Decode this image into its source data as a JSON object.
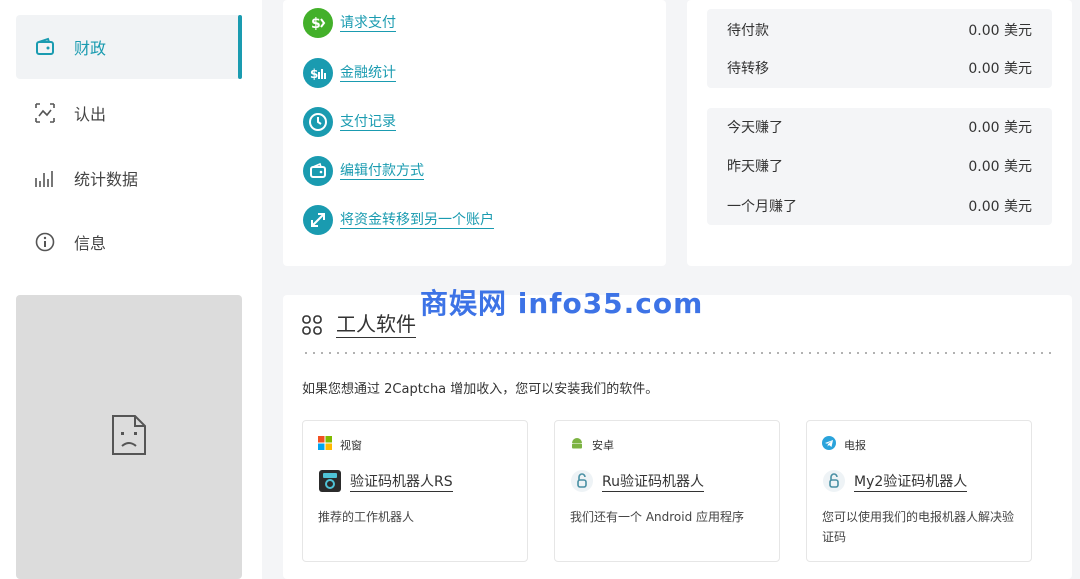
{
  "sidebar": {
    "items": [
      {
        "label": "财政",
        "icon": "wallet-icon",
        "active": true
      },
      {
        "label": "认出",
        "icon": "trend-icon",
        "active": false
      },
      {
        "label": "统计数据",
        "icon": "bar-chart-icon",
        "active": false
      },
      {
        "label": "信息",
        "icon": "info-icon",
        "active": false
      }
    ]
  },
  "finance_links": [
    {
      "label": "请求支付",
      "icon": "dollar-icon",
      "color": "#43b02a"
    },
    {
      "label": "金融统计",
      "icon": "money-stats-icon",
      "color": "#1a9bb0"
    },
    {
      "label": "支付记录",
      "icon": "clock-icon",
      "color": "#1a9bb0"
    },
    {
      "label": "编辑付款方式",
      "icon": "wallet-icon",
      "color": "#1a9bb0"
    },
    {
      "label": "将资金转移到另一个账户",
      "icon": "transfer-icon",
      "color": "#1a9bb0"
    }
  ],
  "balances": {
    "group1": [
      {
        "label": "待付款",
        "value": "0.00 美元"
      },
      {
        "label": "待转移",
        "value": "0.00 美元"
      }
    ],
    "group2": [
      {
        "label": "今天赚了",
        "value": "0.00 美元"
      },
      {
        "label": "昨天赚了",
        "value": "0.00 美元"
      },
      {
        "label": "一个月赚了",
        "value": "0.00 美元"
      }
    ]
  },
  "software": {
    "title": "工人软件",
    "description": "如果您想通过 2Captcha 增加收入，您可以安装我们的软件。",
    "cards": [
      {
        "platform": "视窗",
        "platform_icon": "windows-icon",
        "name": "验证码机器人RS",
        "app_icon": "robot-app-icon",
        "desc": "推荐的工作机器人"
      },
      {
        "platform": "安卓",
        "platform_icon": "android-icon",
        "name": "Ru验证码机器人",
        "app_icon": "lock-icon",
        "desc": "我们还有一个 Android 应用程序"
      },
      {
        "platform": "电报",
        "platform_icon": "telegram-icon",
        "name": "My2验证码机器人",
        "app_icon": "lock-icon",
        "desc": "您可以使用我们的电报机器人解决验证码"
      }
    ]
  },
  "watermark": "商娱网 info35.com",
  "colors": {
    "accent": "#1a9bb0",
    "green": "#43b02a"
  }
}
